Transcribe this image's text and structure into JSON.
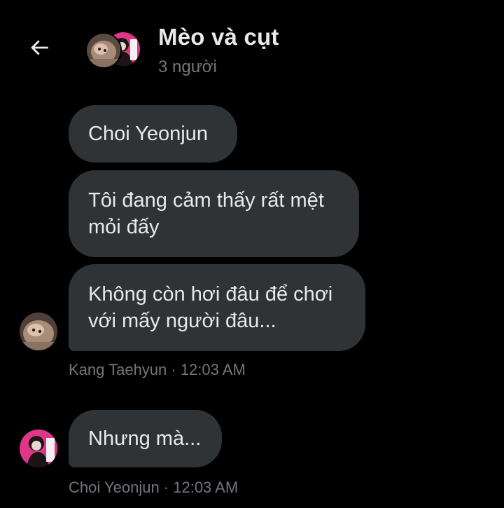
{
  "header": {
    "back_icon": "arrow-left-icon",
    "title": "Mèo và cụt",
    "subtitle": "3 người"
  },
  "messages": [
    {
      "text": "Choi Yeonjun"
    },
    {
      "text": "Tôi đang cảm thấy rất mệt mỏi đấy"
    },
    {
      "text": "Không còn hơi đâu để chơi với mấy người đâu..."
    },
    {
      "text": "Nhưng mà..."
    }
  ],
  "meta": [
    {
      "text": "Kang Taehyun · 12:03 AM"
    },
    {
      "text": "Choi Yeonjun · 12:03 AM"
    }
  ],
  "colors": {
    "background": "#000000",
    "bubble": "#2f3336",
    "text": "#e7e9ea",
    "muted": "#71767b",
    "accent_pink": "#e0368a"
  }
}
